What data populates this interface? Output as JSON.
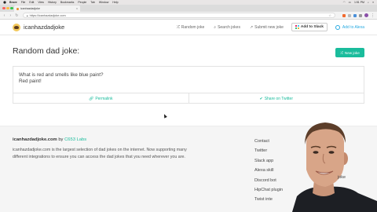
{
  "menubar": {
    "items": [
      "Brave",
      "File",
      "Edit",
      "View",
      "History",
      "Bookmarks",
      "People",
      "Tab",
      "Window",
      "Help"
    ],
    "clock": "1:51 PM"
  },
  "browser": {
    "tab_title": "icanhazdadjoke",
    "url": "https://icanhazdadjoke.com"
  },
  "header": {
    "brand": "icanhazdadjoke",
    "nav": [
      {
        "icon": "shuffle-icon",
        "label": "Random joke"
      },
      {
        "icon": "search-icon",
        "label": "Search jokes"
      },
      {
        "icon": "submit-icon",
        "label": "Submit new joke"
      }
    ],
    "slack_label": "Add to Slack",
    "alexa_label": "Add to Alexa"
  },
  "main": {
    "title": "Random dad joke:",
    "new_joke_label": "New joke",
    "joke_question": "What is red and smells like blue paint?",
    "joke_answer": "Red paint!",
    "permalink_label": "Permalink",
    "share_label": "Share on Twitter"
  },
  "footer": {
    "site": "icanhazdadjoke.com",
    "by": "by",
    "lab": "C653 Labs",
    "description": "icanhazdadjoke.com is the largest selection of dad jokes on the internet. Now supporting many different integrations to ensure you can access the dad jokes that you need wherever you are.",
    "links": [
      "Contact",
      "Twitter",
      "Slack app",
      "Alexa skill",
      "Discord bot",
      "HipChat plugin",
      "Twist inte"
    ],
    "webcam_overlap_text": "joke"
  },
  "colors": {
    "accent": "#1abc9c",
    "alexa": "#27aae1"
  }
}
